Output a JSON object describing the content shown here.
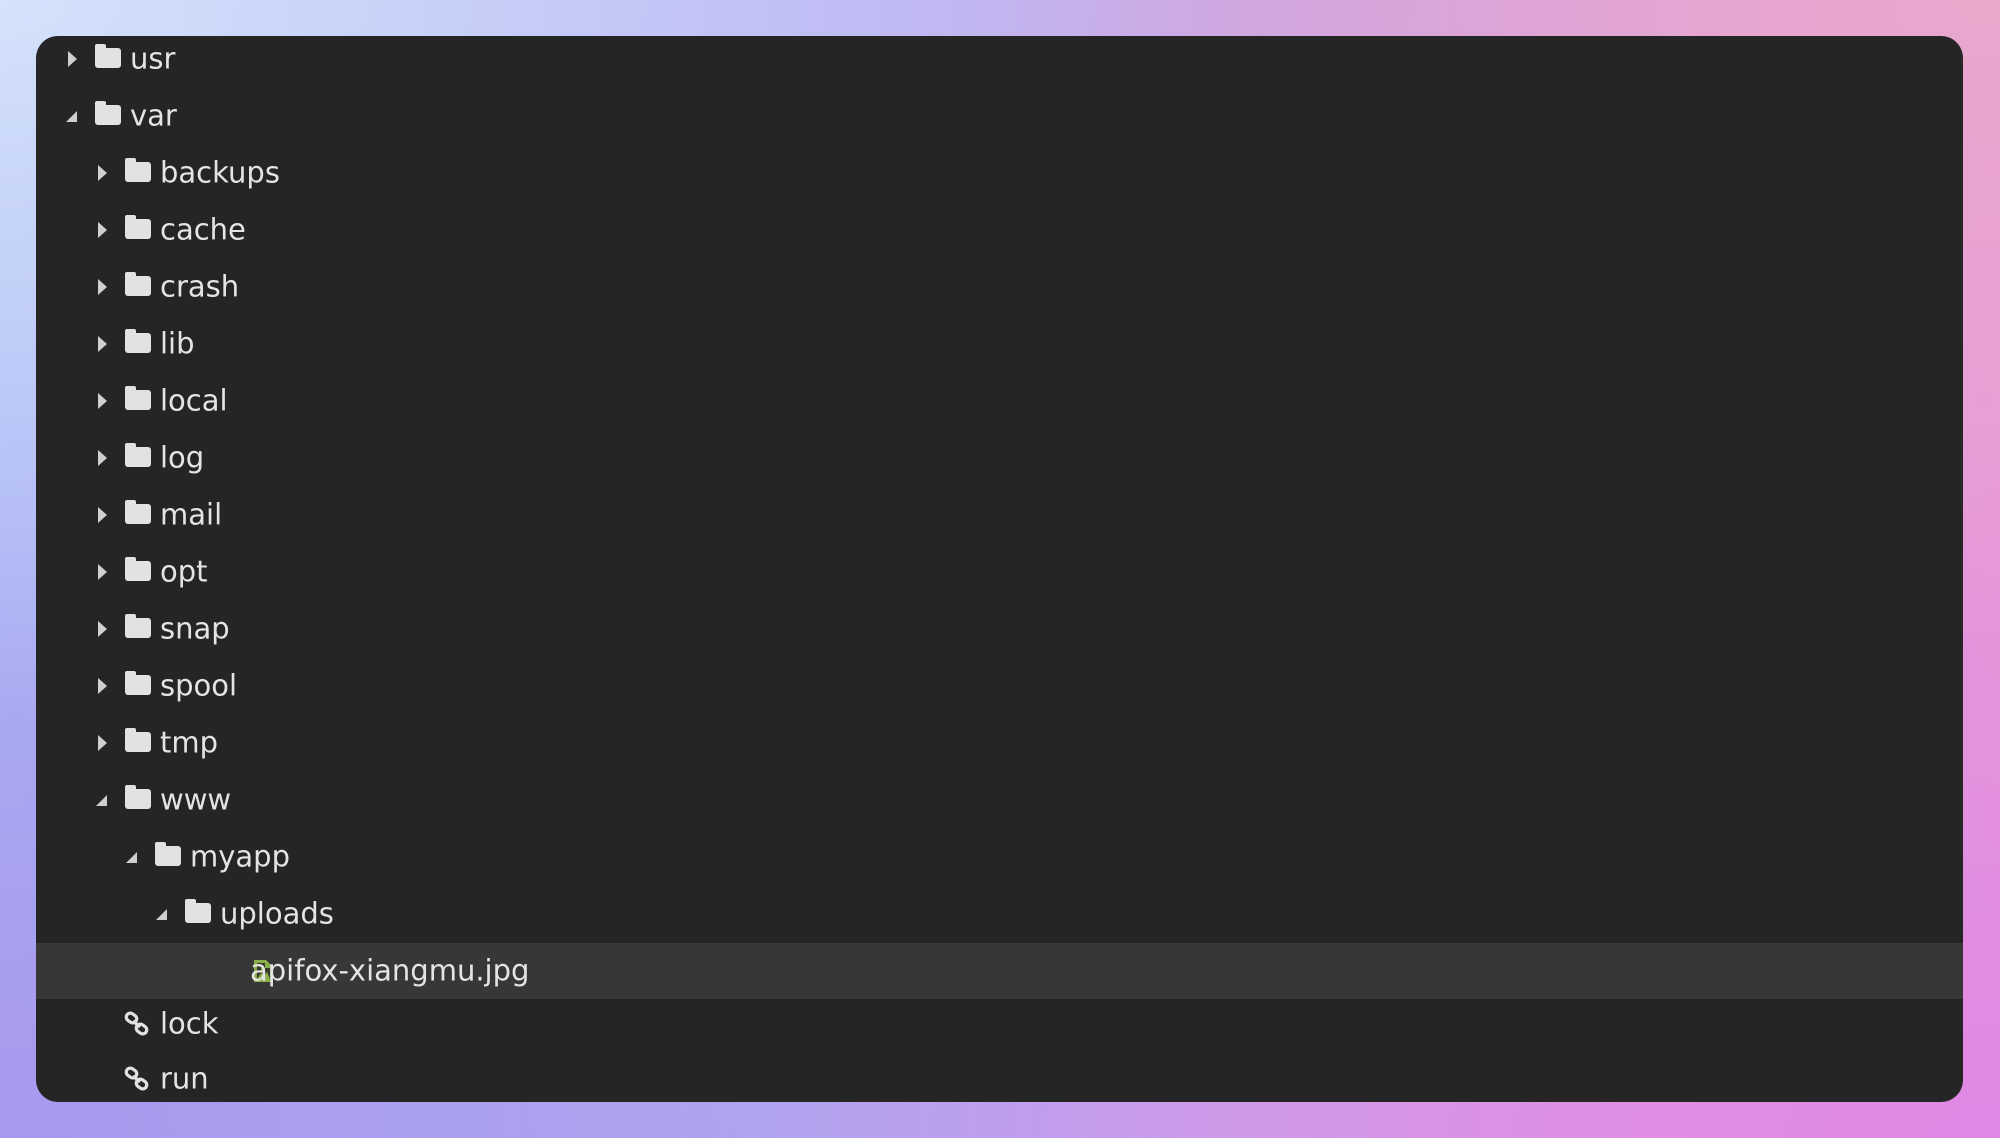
{
  "tree": {
    "items": [
      {
        "name": "usr",
        "depth": 0,
        "type": "folder",
        "expanded": false
      },
      {
        "name": "var",
        "depth": 0,
        "type": "folder",
        "expanded": true
      },
      {
        "name": "backups",
        "depth": 1,
        "type": "folder",
        "expanded": false
      },
      {
        "name": "cache",
        "depth": 1,
        "type": "folder",
        "expanded": false
      },
      {
        "name": "crash",
        "depth": 1,
        "type": "folder",
        "expanded": false
      },
      {
        "name": "lib",
        "depth": 1,
        "type": "folder",
        "expanded": false
      },
      {
        "name": "local",
        "depth": 1,
        "type": "folder",
        "expanded": false
      },
      {
        "name": "log",
        "depth": 1,
        "type": "folder",
        "expanded": false
      },
      {
        "name": "mail",
        "depth": 1,
        "type": "folder",
        "expanded": false
      },
      {
        "name": "opt",
        "depth": 1,
        "type": "folder",
        "expanded": false
      },
      {
        "name": "snap",
        "depth": 1,
        "type": "folder",
        "expanded": false
      },
      {
        "name": "spool",
        "depth": 1,
        "type": "folder",
        "expanded": false
      },
      {
        "name": "tmp",
        "depth": 1,
        "type": "folder",
        "expanded": false
      },
      {
        "name": "www",
        "depth": 1,
        "type": "folder",
        "expanded": true
      },
      {
        "name": "myapp",
        "depth": 2,
        "type": "folder",
        "expanded": true
      },
      {
        "name": "uploads",
        "depth": 3,
        "type": "folder",
        "expanded": true
      },
      {
        "name": "apifox-xiangmu.jpg",
        "depth": 4,
        "type": "image-file",
        "selected": true
      },
      {
        "name": "lock",
        "depth": 1,
        "type": "symlink"
      },
      {
        "name": "run",
        "depth": 1,
        "type": "symlink"
      }
    ]
  },
  "colors": {
    "panel": "#252525",
    "selected_row": "#373737",
    "image_icon": "#8bb04a",
    "text": "#e4e4e4"
  }
}
